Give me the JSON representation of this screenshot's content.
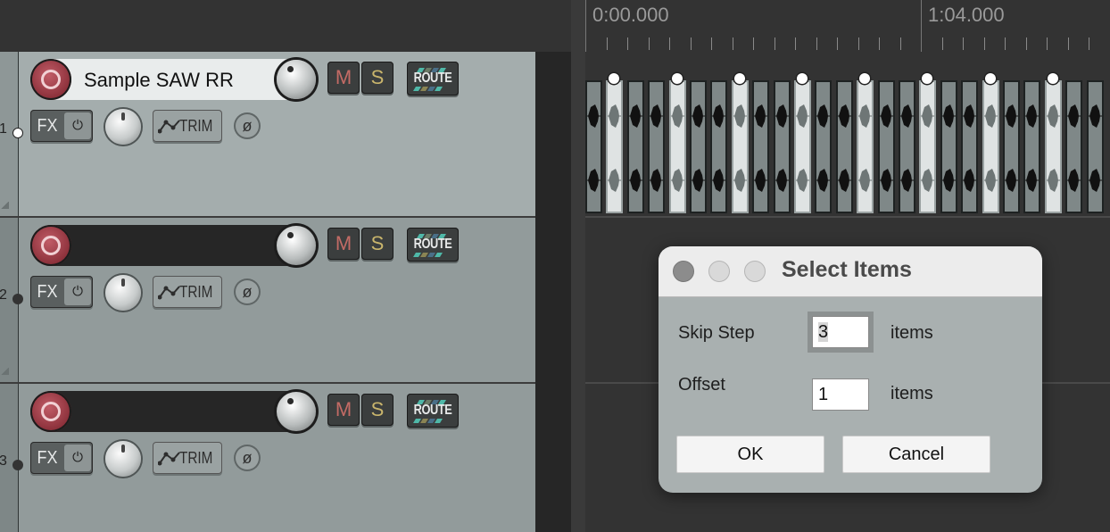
{
  "ruler": {
    "labels": [
      "0:00.000",
      "1:04.000"
    ]
  },
  "tracks": [
    {
      "number": "1",
      "name": "Sample SAW RR",
      "selected": true,
      "buttons": {
        "mute": "M",
        "solo": "S",
        "route": "ROUTE",
        "fx": "FX",
        "trim": "TRIM",
        "fx_power": "⏻",
        "phase": "ø"
      }
    },
    {
      "number": "2",
      "name": "",
      "selected": false,
      "buttons": {
        "mute": "M",
        "solo": "S",
        "route": "ROUTE",
        "fx": "FX",
        "trim": "TRIM",
        "fx_power": "⏻",
        "phase": "ø"
      }
    },
    {
      "number": "3",
      "name": "",
      "selected": false,
      "buttons": {
        "mute": "M",
        "solo": "S",
        "route": "ROUTE",
        "fx": "FX",
        "trim": "TRIM",
        "fx_power": "⏻",
        "phase": "ø"
      }
    }
  ],
  "items": {
    "count": 25,
    "selected_pattern": "every third starting at item 2"
  },
  "dialog": {
    "title": "Select Items",
    "skip_step": {
      "label": "Skip Step",
      "value": "3",
      "unit": "items"
    },
    "offset": {
      "label": "Offset",
      "value": "1",
      "unit": "items"
    },
    "ok_label": "OK",
    "cancel_label": "Cancel"
  },
  "colors": {
    "selected_track_bg": "#a4adad",
    "track_bg": "#929b9b",
    "record_red": "#a13b46",
    "mute_red": "#c36b65",
    "solo_yellow": "#c9b56c",
    "selected_item": "#dfe3e3",
    "unselected_item": "#7f8888"
  }
}
